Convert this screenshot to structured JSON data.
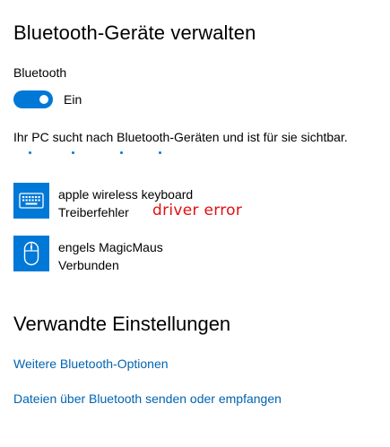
{
  "header": {
    "title": "Bluetooth-Geräte verwalten"
  },
  "bluetooth": {
    "label": "Bluetooth",
    "toggle_on": true,
    "toggle_state": "Ein",
    "status": "Ihr PC sucht nach Bluetooth-Geräten und ist für sie sichtbar."
  },
  "devices": [
    {
      "icon": "keyboard-icon",
      "name": "apple wireless keyboard",
      "status": "Treiberfehler"
    },
    {
      "icon": "mouse-icon",
      "name": "engels MagicMaus",
      "status": "Verbunden"
    }
  ],
  "annotation": {
    "text": "driver error",
    "color": "#e01010"
  },
  "related": {
    "title": "Verwandte Einstellungen",
    "links": [
      "Weitere Bluetooth-Optionen",
      "Dateien über Bluetooth senden oder empfangen"
    ]
  },
  "colors": {
    "accent": "#0078d7",
    "link": "#0063b1"
  }
}
